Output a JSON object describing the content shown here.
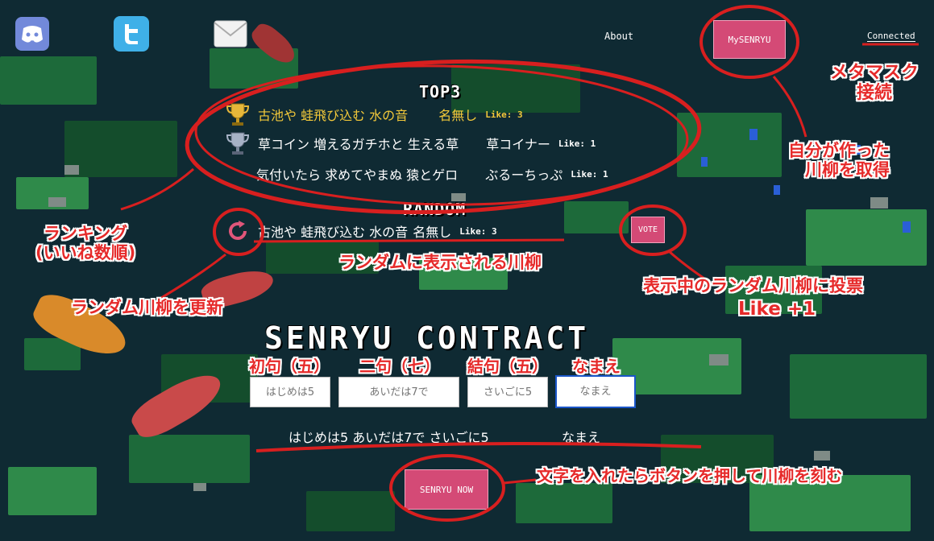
{
  "nav": {
    "discord_icon": "discord-icon",
    "twitter_icon": "twitter-icon",
    "mail_icon": "mail-icon",
    "about_label": "About",
    "mysenryu_label": "MySENRYU",
    "connected_label": "Connected"
  },
  "top3": {
    "title": "TOP3",
    "entries": [
      {
        "poem": "古池や 蛙飛び込む 水の音",
        "author": "名無し",
        "like": "Like: 3",
        "trophy": "gold"
      },
      {
        "poem": "草コイン 増えるガチホと 生える草",
        "author": "草コイナー",
        "like": "Like: 1",
        "trophy": "silver"
      },
      {
        "poem": "気付いたら 求めてやまぬ 猿とゲロ",
        "author": "ぶるーちっぷ",
        "like": "Like: 1",
        "trophy": "none"
      }
    ]
  },
  "random": {
    "title": "RANDOM",
    "poem": "古池や 蛙飛び込む 水の音",
    "author": "名無し",
    "like": "Like: 3",
    "vote_label": "VOTE"
  },
  "contract": {
    "title": "SENRYU CONTRACT",
    "fields": [
      {
        "label": "初句（五）",
        "value": "はじめは5"
      },
      {
        "label": "二句（七）",
        "value": "あいだは7で"
      },
      {
        "label": "結句（五）",
        "value": "さいごに5"
      },
      {
        "label": "なまえ",
        "value": "なまえ"
      }
    ],
    "preview_poem": "はじめは5 あいだは7で さいごに5",
    "preview_name": "なまえ",
    "submit_label": "SENRYU NOW"
  },
  "annotations": {
    "metamask": "メタマスク\n接続",
    "my_senryu": "自分が作った\n川柳を取得",
    "ranking": "ランキング\n(いいね数順)",
    "random_shown": "ランダムに表示される川柳",
    "refresh": "ランダム川柳を更新",
    "vote": "表示中のランダム川柳に投票",
    "vote_like": "Like +1",
    "submit": "文字を入れたらボタンを押して川柳を刻む"
  },
  "colors": {
    "accent_pink": "#d44a76",
    "annotation_red": "#e62a2a",
    "gold": "#f2c83a"
  }
}
